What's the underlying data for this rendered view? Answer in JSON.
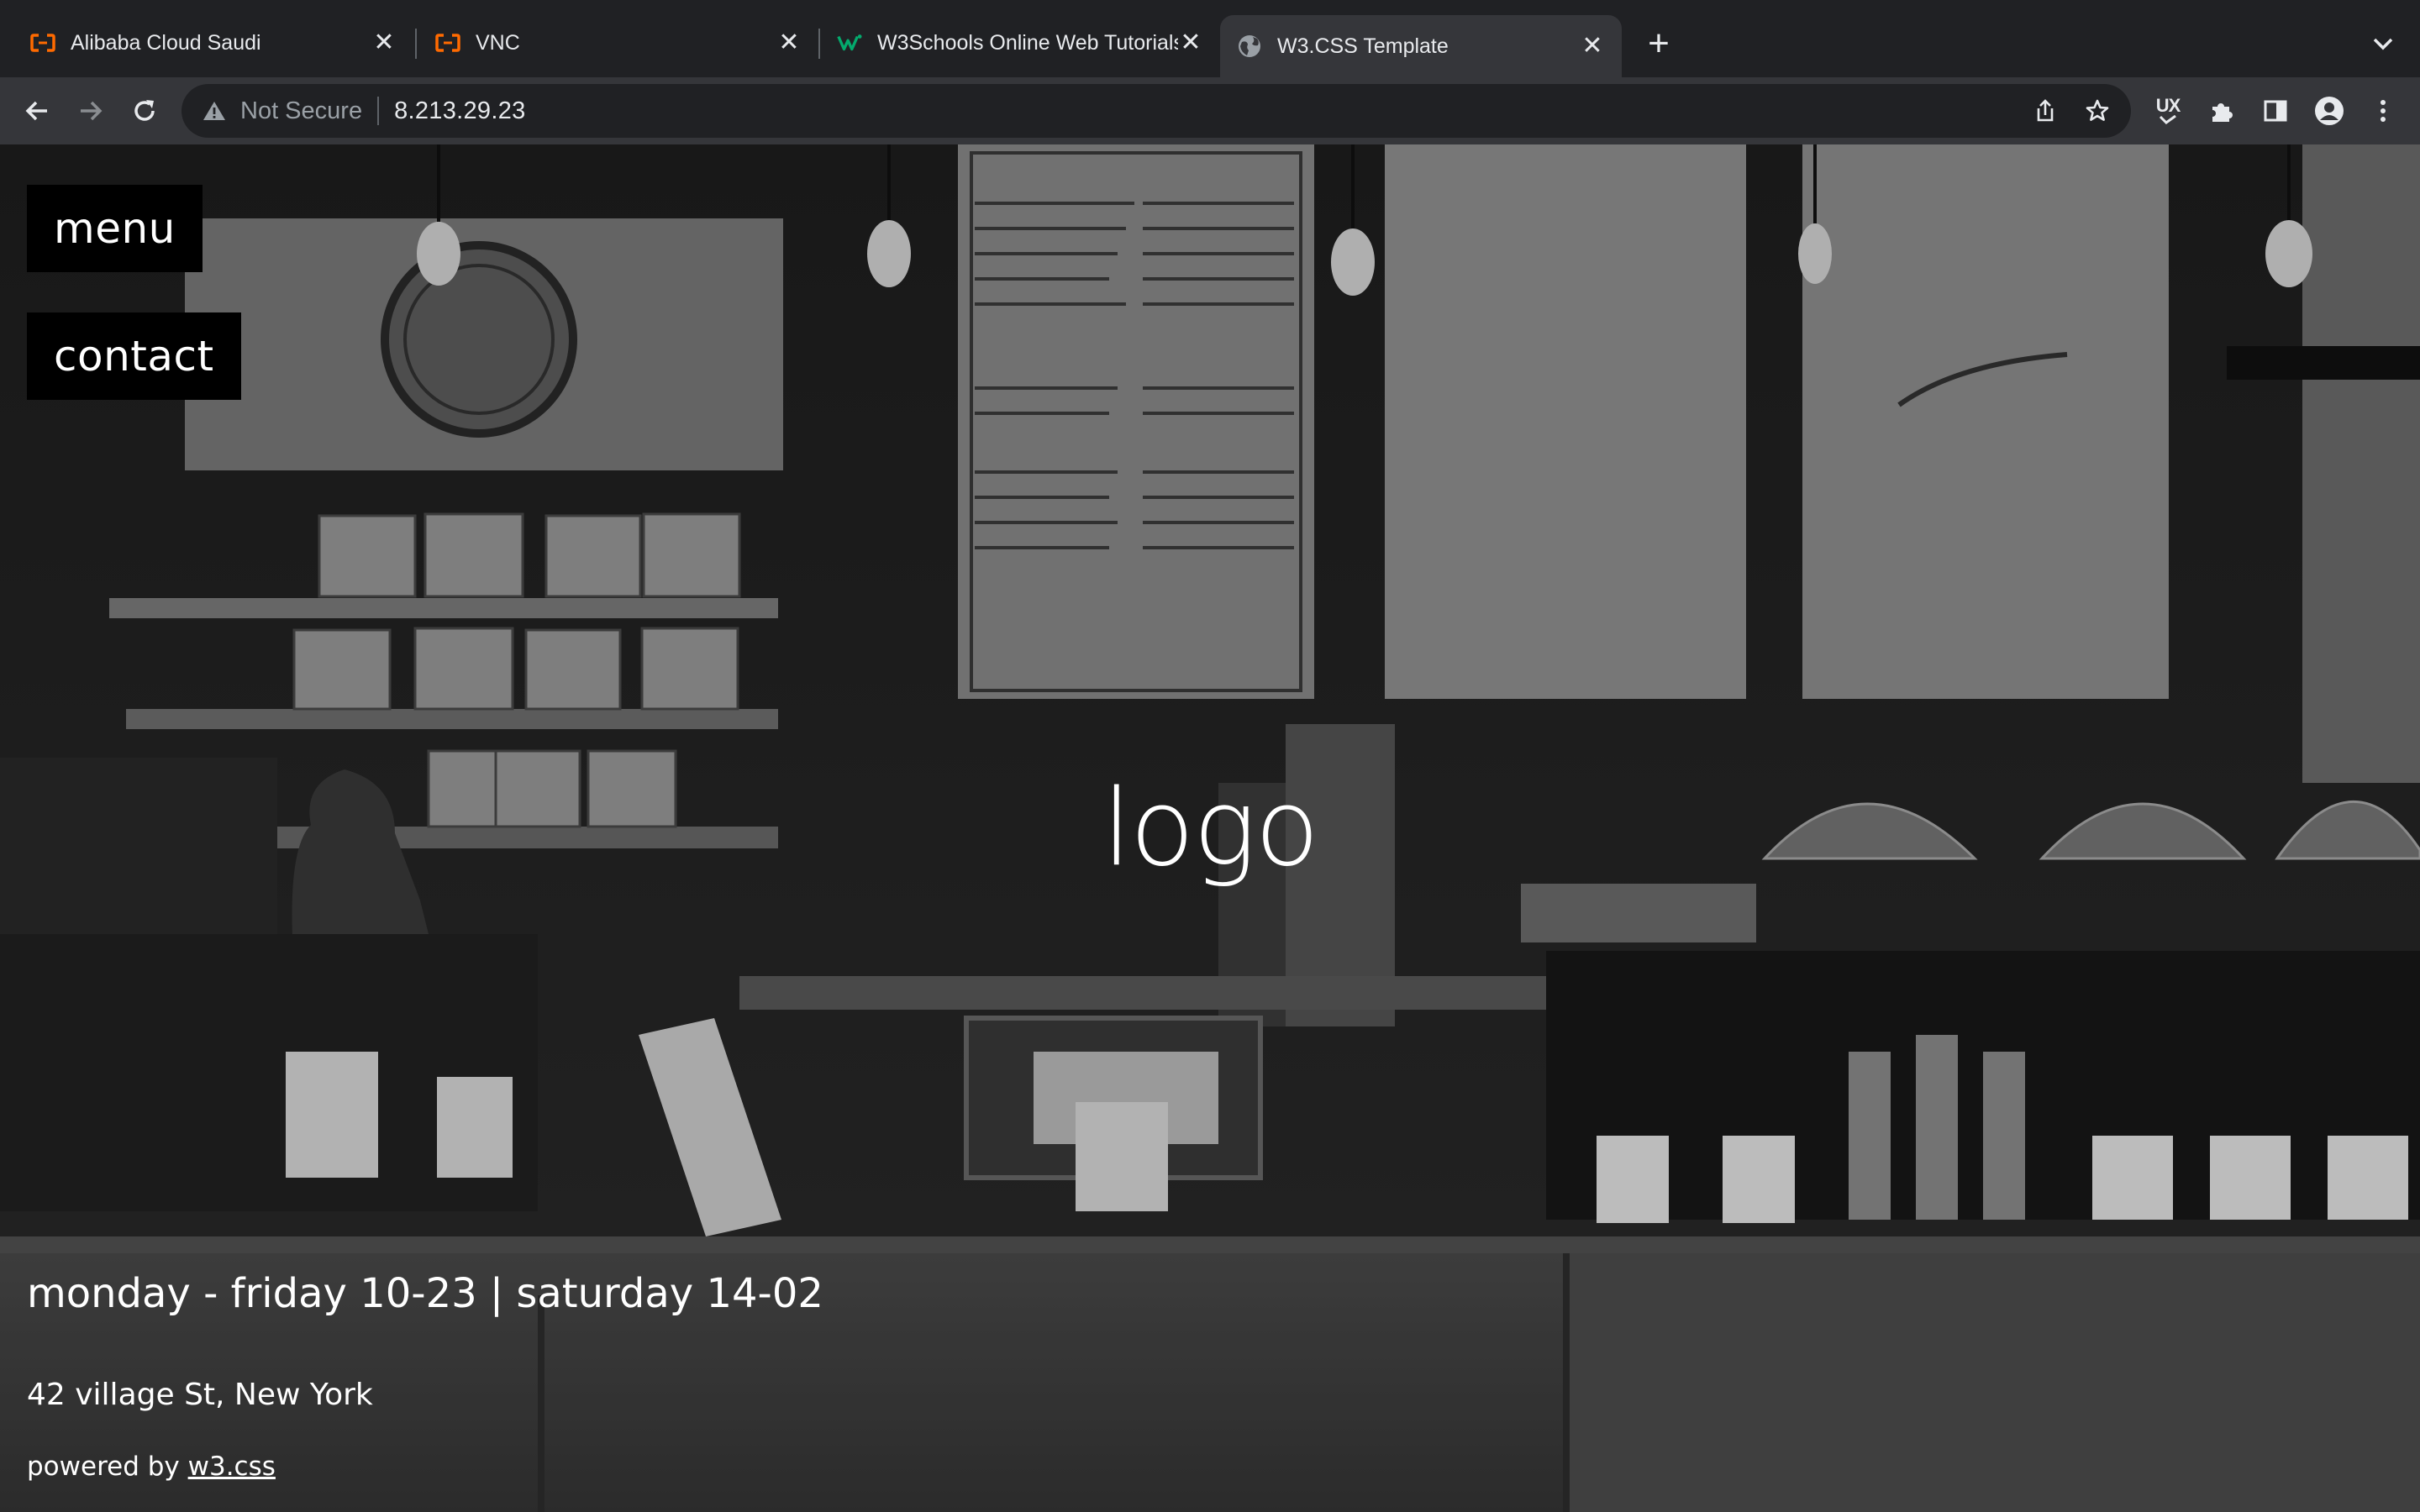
{
  "browser": {
    "tabs": [
      {
        "title": "Alibaba Cloud Saudi",
        "favicon": "alibaba-cloud-icon",
        "active": false
      },
      {
        "title": "VNC",
        "favicon": "alibaba-cloud-icon",
        "active": false
      },
      {
        "title": "W3Schools Online Web Tutorials",
        "favicon": "w3schools-icon",
        "active": false
      },
      {
        "title": "W3.CSS Template",
        "favicon": "globe-icon",
        "active": true
      }
    ],
    "close_glyph": "✕",
    "new_tab_glyph": "+",
    "security_label": "Not Secure",
    "url": "8.213.29.23",
    "extension_badge": "UX"
  },
  "page": {
    "menu_button": "menu",
    "contact_button": "contact",
    "logo": "logo",
    "hours": "monday - friday 10-23 | saturday 14-02",
    "address": "42 village St, New York",
    "powered_prefix": "powered by ",
    "powered_link": "w3.css"
  },
  "colors": {
    "chrome_bg": "#202124",
    "toolbar_bg": "#35363a",
    "text": "#e8eaed",
    "accent_alibaba": "#ff6a00",
    "accent_w3schools": "#04aa6d"
  }
}
